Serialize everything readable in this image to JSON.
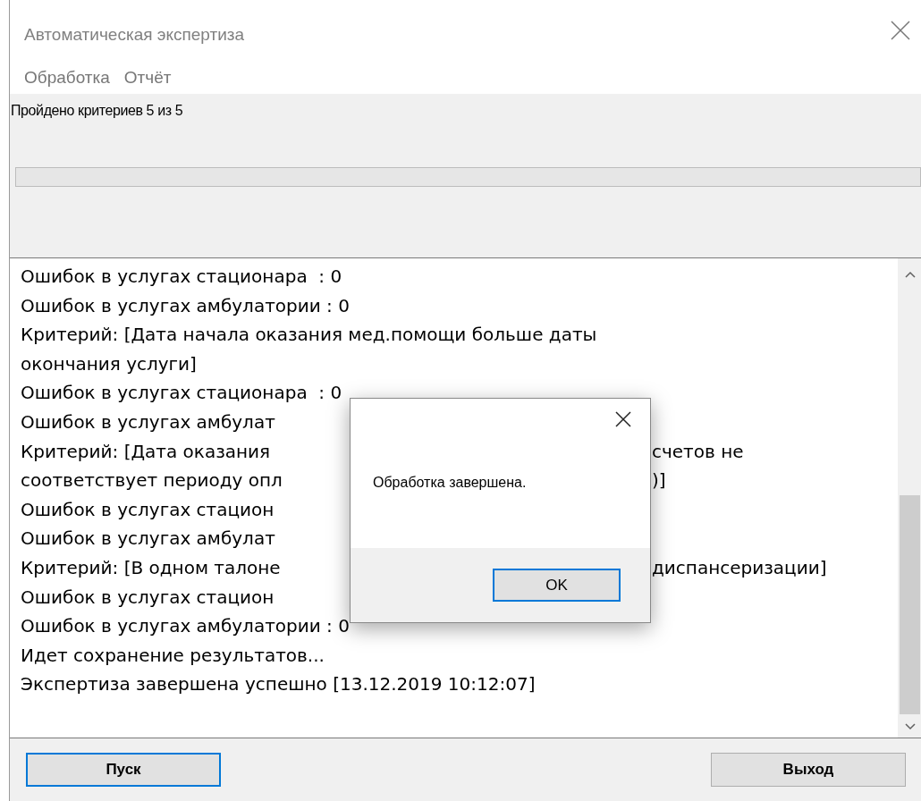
{
  "window": {
    "title": "Автоматическая экспертиза"
  },
  "menu": [
    {
      "label": "Обработка"
    },
    {
      "label": "Отчёт"
    }
  ],
  "status": {
    "text": "Пройдено критериев 5 из 5"
  },
  "log": {
    "lines": [
      {
        "text": "Ошибок в услугах стационара  : 0"
      },
      {
        "text": "Ошибок в услугах амбулатории : 0"
      },
      {
        "text": "Критерий: [Дата начала оказания мед.помощи больше даты"
      },
      {
        "text": "окончания услуги]"
      },
      {
        "text": "Ошибок в услугах стационара  : 0"
      },
      {
        "text": "Ошибок в услугах амбулат"
      },
      {
        "text": "Критерий: [Дата оказания",
        "tail": "счетов не"
      },
      {
        "text": "соответствует периоду опл",
        "tail": ")]"
      },
      {
        "text": "Ошибок в услугах стацион"
      },
      {
        "text": "Ошибок в услугах амбулат"
      },
      {
        "text": "Критерий: [В одном талоне",
        "tail": "диспансеризации]"
      },
      {
        "text": "Ошибок в услугах стацион"
      },
      {
        "text": "Ошибок в услугах амбулатории : 0"
      },
      {
        "text": "Идет сохранение результатов..."
      },
      {
        "text": "Экспертиза завершена успешно [13.12.2019 10:12:07]"
      }
    ]
  },
  "buttons": [
    {
      "label": "Пуск",
      "focused": true
    },
    {
      "label": "Выход",
      "focused": false
    }
  ],
  "dialog": {
    "message": "Обработка завершена.",
    "buttons": [
      {
        "label": "OK",
        "focused": true
      }
    ]
  }
}
